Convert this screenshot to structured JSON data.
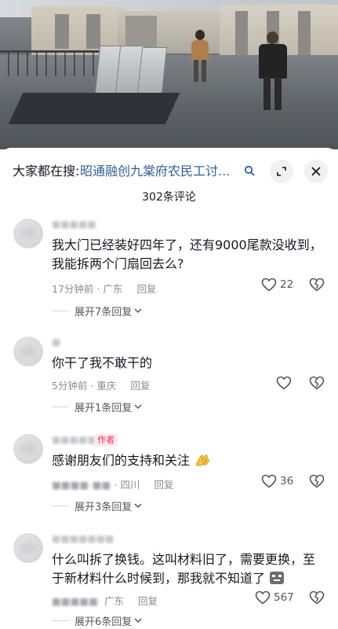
{
  "sheet": {
    "search_prefix": "大家都在搜:",
    "search_query": "昭通融创九棠府农民工讨...",
    "comment_count_label": "302条评论"
  },
  "comments": [
    {
      "text": "我大门已经装好四年了，还有9000尾款没收到，我能拆两个门扇回去么?",
      "time": "17分钟前",
      "location": "广东",
      "reply_label": "回复",
      "likes": "22",
      "expand_label": "展开7条回复"
    },
    {
      "text": "你干了我不敢干的",
      "time": "5分钟前",
      "location": "重庆",
      "reply_label": "回复",
      "likes": "",
      "expand_label": "展开1条回复"
    },
    {
      "author_tag": "作者",
      "text": "感谢朋友们的支持和关注",
      "location": "四川",
      "reply_label": "回复",
      "likes": "36",
      "expand_label": "展开3条回复"
    },
    {
      "text": "什么叫拆了换钱。这叫材料旧了，需要更换，至于新材料什么时候到，那我就不知道了",
      "location": "广东",
      "reply_label": "回复",
      "likes": "567",
      "expand_label": "展开6条回复"
    }
  ],
  "icons": {
    "search": "search-icon",
    "expand": "fullscreen-icon",
    "close": "close-icon",
    "like": "heart-outline-icon",
    "dislike": "broken-heart-icon",
    "chevron": "chevron-down-icon"
  },
  "colors": {
    "link": "#2f5e9b",
    "author_tag": "#fe2c55",
    "meta": "#8a8b91"
  }
}
